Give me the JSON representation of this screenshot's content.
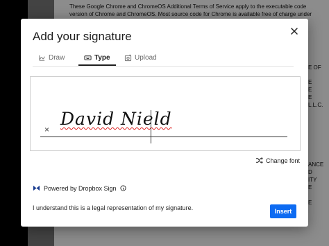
{
  "background_document": {
    "lines": [
      "These Google Chrome and ChromeOS Additional Terms of Service apply to the executable code",
      "version of Chrome and ChromeOS. Most source code for Chrome is available free of charge under"
    ],
    "right_fragments": [
      "E OF",
      "E",
      "E",
      "E",
      "L.L.C.",
      "ANCE",
      "D",
      "ITY",
      "E",
      "E"
    ]
  },
  "dialog": {
    "title": "Add your signature",
    "close_icon": "close-icon",
    "tabs": [
      {
        "label": "Draw",
        "icon": "draw-icon",
        "active": false
      },
      {
        "label": "Type",
        "icon": "keyboard-icon",
        "active": true
      },
      {
        "label": "Upload",
        "icon": "image-upload-icon",
        "active": false
      }
    ],
    "signature": {
      "marker": "×",
      "typed_text": "David Nield"
    },
    "change_font_label": "Change font",
    "powered_by": "Powered by Dropbox Sign",
    "disclaimer": "I understand this is a legal representation of my signature.",
    "insert_label": "Insert",
    "colors": {
      "primary": "#0d6bf2",
      "text": "#1e1e1e",
      "dropbox_logo": "#1a3c8f"
    }
  }
}
